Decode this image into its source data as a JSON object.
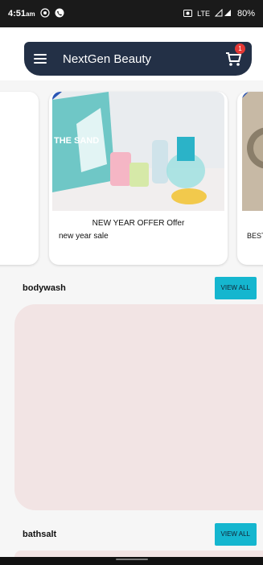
{
  "status_bar": {
    "time": "4:51",
    "ampm": "am",
    "network": "LTE",
    "battery": "80%"
  },
  "app_bar": {
    "title": "NextGen Beauty",
    "cart_count": "1",
    "icons": [
      "menu-icon",
      "cart-icon"
    ]
  },
  "carousel": {
    "main": {
      "image_text": "THE SAND",
      "title": "NEW YEAR OFFER Offer",
      "subtitle": "new year sale"
    },
    "right": {
      "label": "BEST"
    }
  },
  "sections": [
    {
      "title": "bodywash",
      "button": "VIEW ALL"
    },
    {
      "title": "bathsalt",
      "button": "VIEW ALL"
    }
  ],
  "colors": {
    "app_bar_bg": "#233046",
    "accent": "#15b6cf",
    "panel_bg": "#f2e4e4",
    "badge": "#e53935"
  }
}
